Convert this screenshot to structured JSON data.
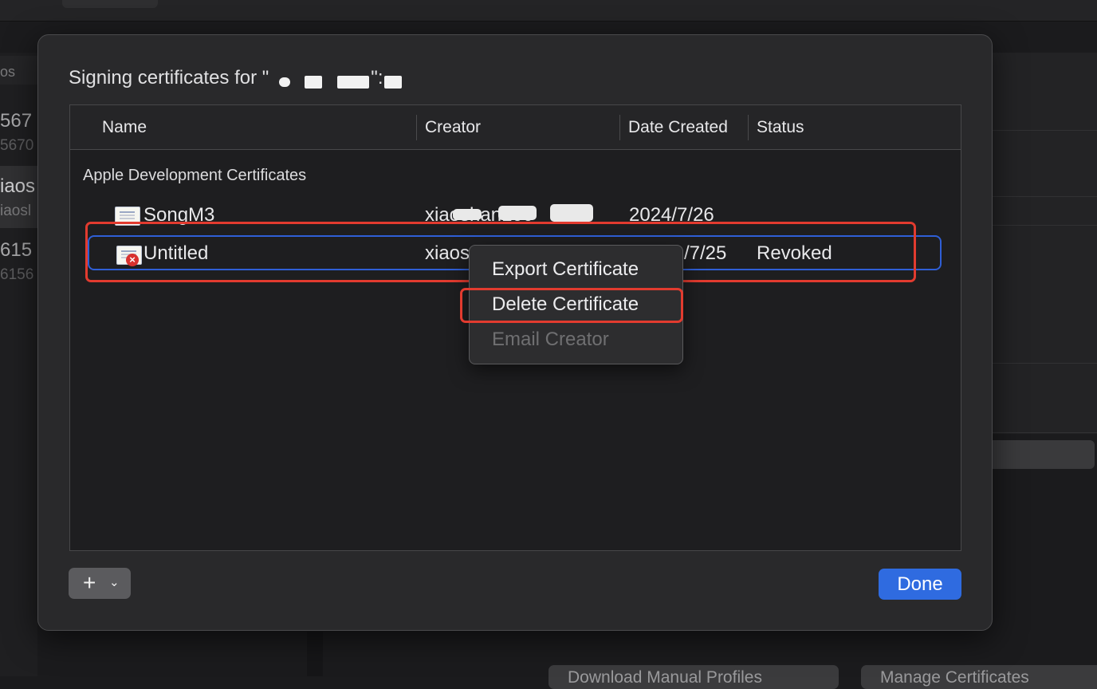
{
  "background": {
    "left_list": {
      "header": "os",
      "items": [
        {
          "title": "567",
          "subtitle": "5670"
        },
        {
          "title": "iaos",
          "subtitle": "iaosl"
        },
        {
          "title": "615",
          "subtitle": "6156"
        }
      ]
    },
    "bottom_buttons": [
      {
        "label": "Download Manual Profiles"
      },
      {
        "label": "Manage Certificates"
      }
    ]
  },
  "dialog": {
    "title": "Signing certificates for \"",
    "title_suffix": "\":",
    "columns": [
      "Name",
      "Creator",
      "Date Created",
      "Status"
    ],
    "section": "Apple Development Certificates",
    "rows": [
      {
        "name": "SongM3",
        "creator": "xiaoshan100",
        "date": "2024/7/26",
        "status": "",
        "icon": "certificate-icon",
        "revoked": false
      },
      {
        "name": "Untitled",
        "creator": "xiaos",
        "date": "/7/25",
        "status": "Revoked",
        "icon": "certificate-revoked-icon",
        "revoked": true
      }
    ],
    "context_menu": {
      "items": [
        {
          "label": "Export Certificate",
          "enabled": true
        },
        {
          "label": "Delete Certificate",
          "enabled": true
        },
        {
          "label": "Email Creator",
          "enabled": false
        }
      ]
    },
    "add_button": {
      "icon": "plus-icon",
      "chevron": "chevron-down-icon"
    },
    "done_label": "Done"
  },
  "colors": {
    "accent": "#2f6be0",
    "highlight_red": "#e23b2f",
    "selection_blue": "#2f5fd6"
  }
}
